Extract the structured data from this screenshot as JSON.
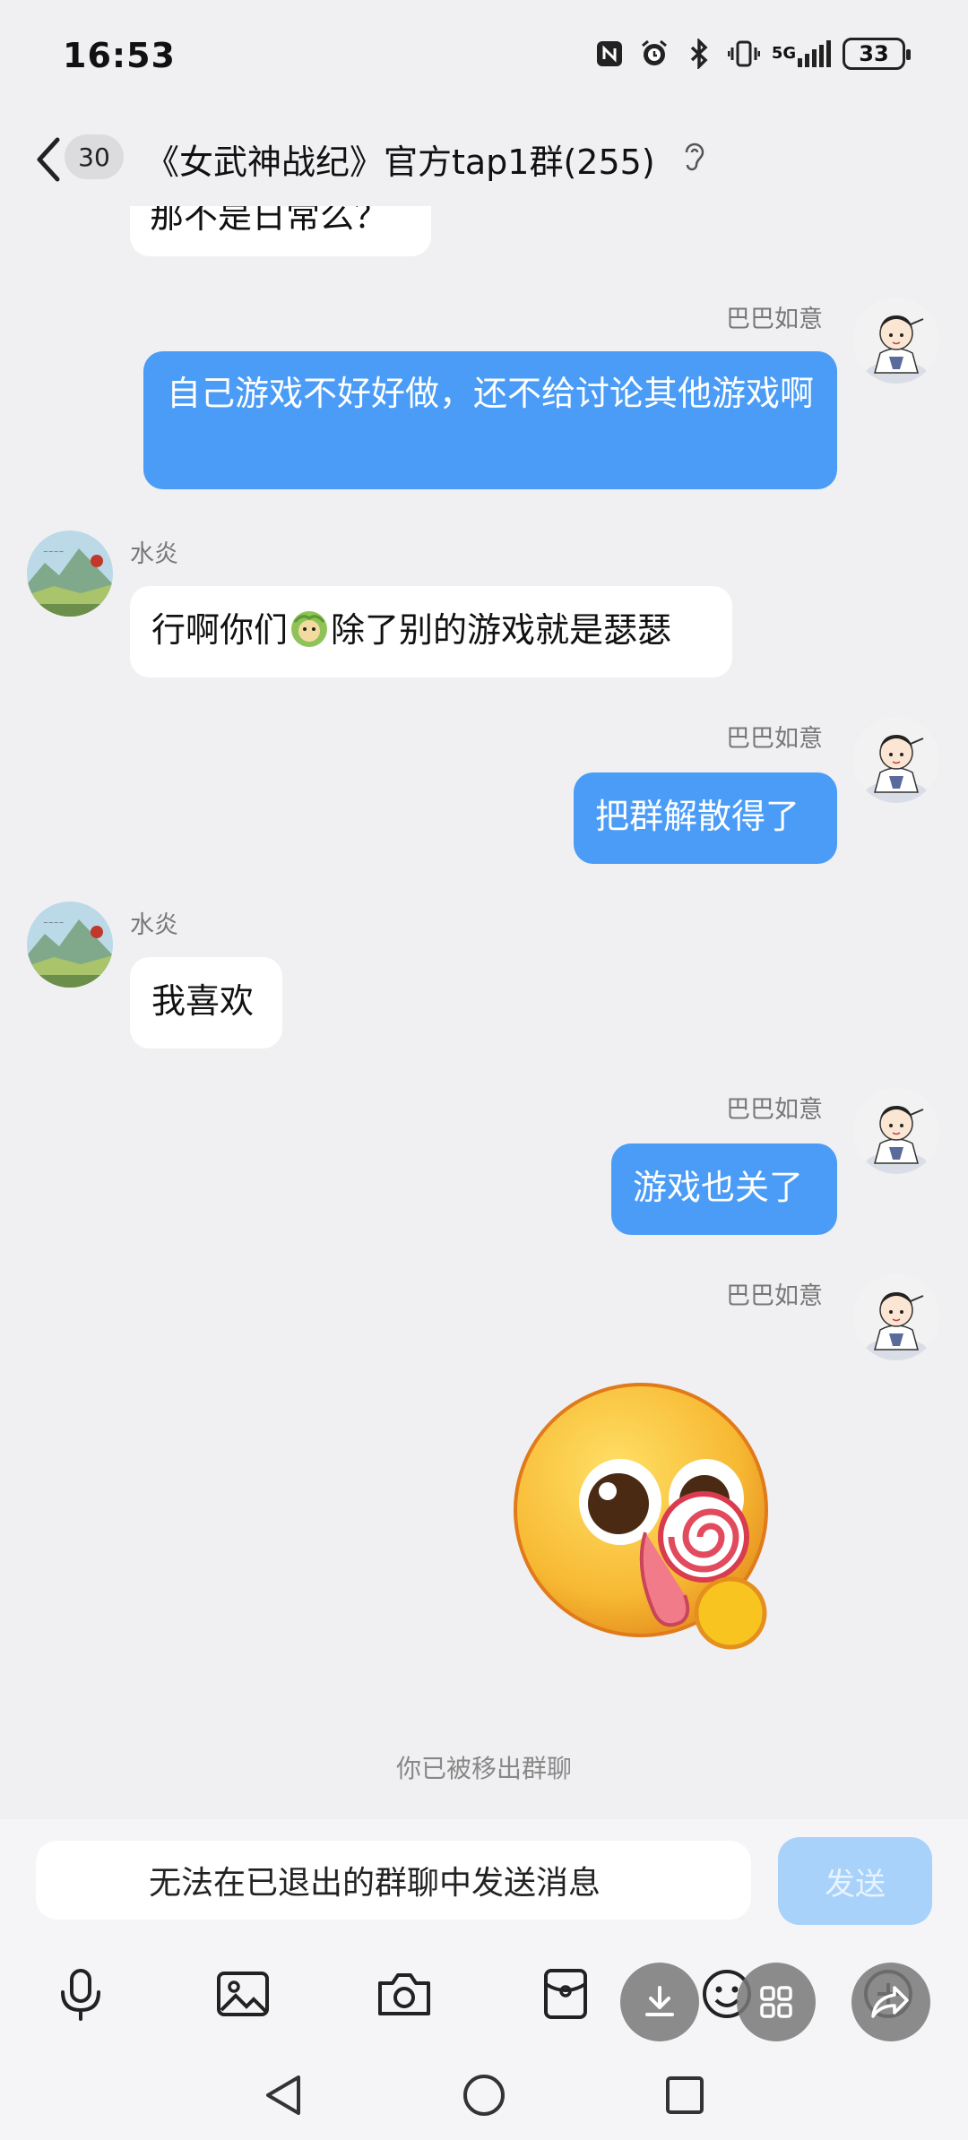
{
  "status_bar": {
    "time": "16:53",
    "network": "5G",
    "battery": "33",
    "icons": [
      "nfc-icon",
      "alarm-icon",
      "bluetooth-icon",
      "vibrate-icon",
      "signal-icon",
      "battery-icon"
    ]
  },
  "header": {
    "unread_count": "30",
    "title": "《女武神战纪》官方tap1群(255)",
    "icons": [
      "back-icon",
      "ear-icon"
    ]
  },
  "messages": [
    {
      "type": "incoming_partial",
      "sender": "",
      "text": "那不是日常么？"
    },
    {
      "type": "outgoing",
      "sender": "巴巴如意",
      "text": "自己游戏不好好做，还不给讨论其他游戏啊"
    },
    {
      "type": "incoming",
      "sender": "水炎",
      "text_before": "行啊你们",
      "emoji": "cabbage-dog-emoji",
      "text_after": "除了别的游戏就是瑟瑟"
    },
    {
      "type": "outgoing",
      "sender": "巴巴如意",
      "text": "把群解散得了"
    },
    {
      "type": "incoming",
      "sender": "水炎",
      "text": "我喜欢"
    },
    {
      "type": "outgoing",
      "sender": "巴巴如意",
      "text": "游戏也关了"
    },
    {
      "type": "outgoing_sticker",
      "sender": "巴巴如意",
      "sticker": "lollipop-eye-emoji-sticker"
    }
  ],
  "system_tip": "你已被移出群聊",
  "input": {
    "placeholder": "无法在已退出的群聊中发送消息",
    "send_label": "发送"
  },
  "toolbar": [
    "microphone-icon",
    "image-icon",
    "camera-icon",
    "red-packet-icon",
    "emoji-icon",
    "plus-icon"
  ],
  "floating_actions": [
    "download-icon",
    "apps-grid-icon",
    "share-icon"
  ],
  "nav": [
    "back-triangle-icon",
    "home-circle-icon",
    "recents-square-icon"
  ],
  "colors": {
    "background": "#f0f0f2",
    "outgoing_bubble": "#4a9cf7",
    "incoming_bubble": "#ffffff",
    "send_button_disabled": "#a9d2fb"
  }
}
